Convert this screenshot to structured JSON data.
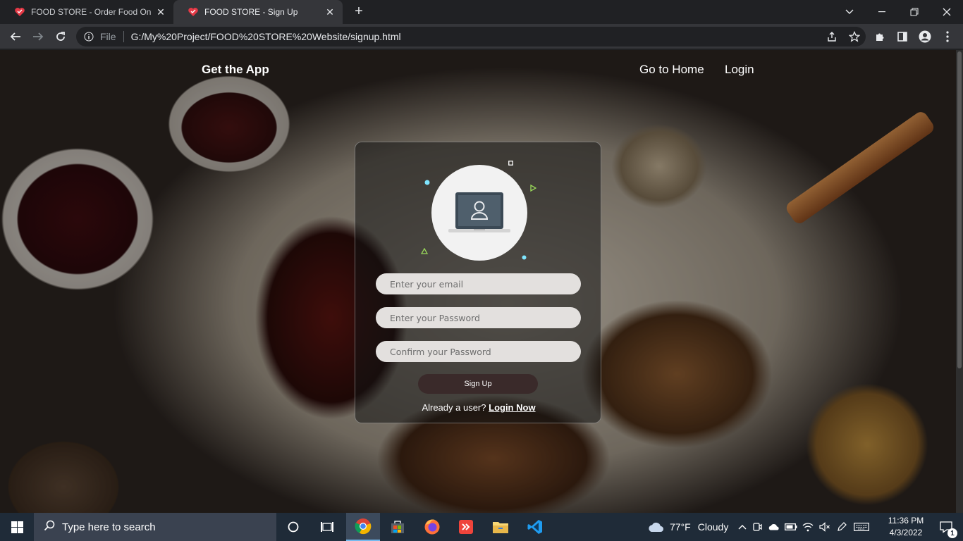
{
  "browser": {
    "tabs": [
      {
        "title": "FOOD STORE - Order Food Onlin",
        "active": false
      },
      {
        "title": "FOOD STORE - Sign Up",
        "active": true
      }
    ],
    "address": {
      "file_label": "File",
      "url": "G:/My%20Project/FOOD%20STORE%20Website/signup.html"
    }
  },
  "page": {
    "nav": {
      "brand": "Get the App",
      "home": "Go to Home",
      "login": "Login"
    },
    "form": {
      "email_placeholder": "Enter your email",
      "password_placeholder": "Enter your Password",
      "confirm_placeholder": "Confirm your Password",
      "submit_label": "Sign Up",
      "already_text": "Already a user?",
      "login_link": "Login Now"
    }
  },
  "taskbar": {
    "search_placeholder": "Type here to search",
    "weather": {
      "temp": "77°F",
      "condition": "Cloudy"
    },
    "clock": {
      "time": "11:36 PM",
      "date": "4/3/2022"
    },
    "notification_count": "1"
  },
  "colors": {
    "accent": "#76b9ed",
    "button": "#3a2a2a",
    "tab_active": "#35363a"
  }
}
